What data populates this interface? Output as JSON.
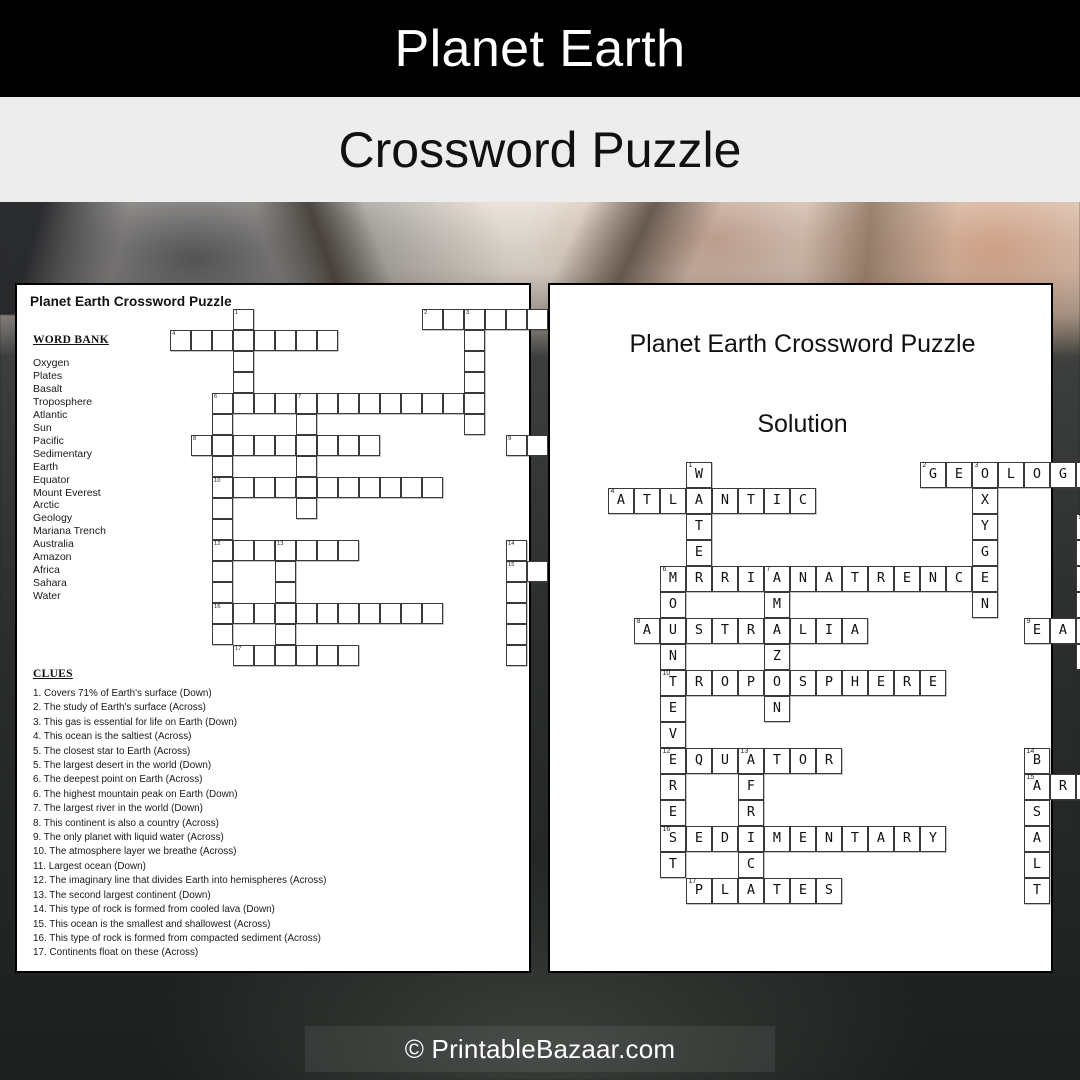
{
  "banner": {
    "title": "Planet Earth",
    "subtitle": "Crossword Puzzle"
  },
  "puzzle_sheet": {
    "heading": "Planet Earth Crossword Puzzle",
    "wordbank_title": "WORD BANK",
    "wordbank": [
      "Oxygen",
      "Plates",
      "Basalt",
      "Troposphere",
      "Atlantic",
      "Sun",
      "Pacific",
      "Sedimentary",
      "Earth",
      "Equator",
      "Mount Everest",
      "Arctic",
      "Geology",
      "Mariana Trench",
      "Australia",
      "Amazon",
      "Africa",
      "Sahara",
      "Water"
    ],
    "clues_title": "CLUES",
    "clues": [
      "1. Covers 71% of Earth's surface (Down)",
      "2. The study of Earth's surface (Across)",
      "3. This gas is essential for life on Earth (Down)",
      "4. This ocean is the saltiest (Across)",
      "5. The closest star to Earth (Across)",
      "5. The largest desert in the world (Down)",
      "6. The deepest point on Earth (Across)",
      "6. The highest mountain peak on Earth (Down)",
      "7. The largest river in the world (Down)",
      "8. This continent is also a country (Across)",
      "9. The only planet with liquid water (Across)",
      "10. The atmosphere layer we breathe (Across)",
      "11. Largest ocean (Down)",
      "12. The imaginary line that divides Earth into hemispheres (Across)",
      "13. The second largest continent (Down)",
      "14. This type of rock is formed from cooled lava (Down)",
      "15. This ocean is the smallest and shallowest (Across)",
      "16. This type of rock is formed from compacted sediment (Across)",
      "17. Continents float on these (Across)"
    ]
  },
  "solution_sheet": {
    "heading": "Planet Earth Crossword Puzzle",
    "subheading": "Solution"
  },
  "footer": {
    "watermark": "© PrintableBazaar.com"
  },
  "crossword": {
    "cols": 25,
    "rows": 18,
    "entries": [
      {
        "number": 1,
        "answer": "WATER",
        "dir": "down",
        "col": 3,
        "row": 0
      },
      {
        "number": 2,
        "answer": "GEOLOGY",
        "dir": "across",
        "col": 12,
        "row": 0
      },
      {
        "number": 3,
        "answer": "OXYGEN",
        "dir": "down",
        "col": 14,
        "row": 0
      },
      {
        "number": 4,
        "answer": "ATLANTIC",
        "dir": "across",
        "col": 0,
        "row": 1
      },
      {
        "number": 5,
        "answer": "SUN",
        "dir": "across",
        "col": 18,
        "row": 2
      },
      {
        "number": 5,
        "answer": "SAHARA",
        "dir": "down",
        "col": 18,
        "row": 2
      },
      {
        "number": 6,
        "answer": "MARIANATRENCH",
        "dir": "across",
        "col": 2,
        "row": 4
      },
      {
        "number": 6,
        "answer": "MOUNTEVEREST",
        "dir": "down",
        "col": 2,
        "row": 4
      },
      {
        "number": 7,
        "answer": "AMAZON",
        "dir": "down",
        "col": 6,
        "row": 4
      },
      {
        "number": 8,
        "answer": "AUSTRALIA",
        "dir": "across",
        "col": 1,
        "row": 6
      },
      {
        "number": 9,
        "answer": "EARTH",
        "dir": "across",
        "col": 16,
        "row": 6
      },
      {
        "number": 10,
        "answer": "TROPOSPHERE",
        "dir": "across",
        "col": 2,
        "row": 8
      },
      {
        "number": 11,
        "answer": "PACIFIC",
        "dir": "down",
        "col": 22,
        "row": 10
      },
      {
        "number": 12,
        "answer": "EQUATOR",
        "dir": "across",
        "col": 2,
        "row": 11
      },
      {
        "number": 13,
        "answer": "AFRICA",
        "dir": "down",
        "col": 5,
        "row": 11
      },
      {
        "number": 14,
        "answer": "BASALT",
        "dir": "down",
        "col": 16,
        "row": 11
      },
      {
        "number": 15,
        "answer": "ARCTIC",
        "dir": "across",
        "col": 16,
        "row": 12
      },
      {
        "number": 16,
        "answer": "SEDIMENTARY",
        "dir": "across",
        "col": 2,
        "row": 14
      },
      {
        "number": 17,
        "answer": "PLATES",
        "dir": "across",
        "col": 3,
        "row": 16
      }
    ]
  }
}
